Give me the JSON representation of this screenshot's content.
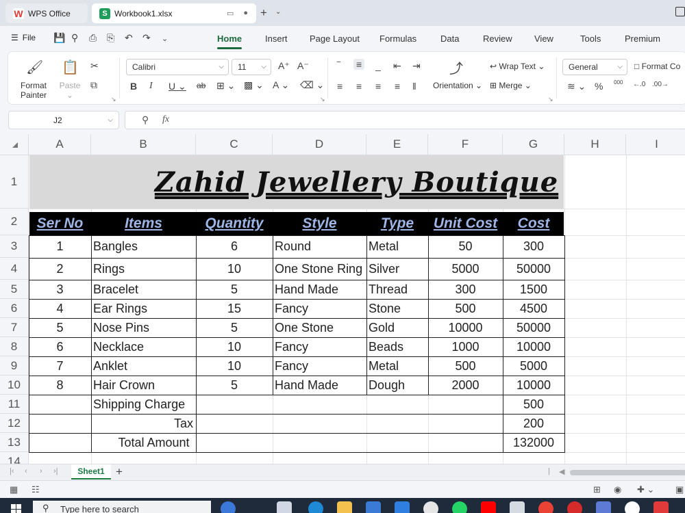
{
  "window": {
    "tabs": [
      {
        "label": "WPS Office",
        "logo": "W"
      },
      {
        "label": "Workbook1.xlsx",
        "logo": "S"
      }
    ]
  },
  "menu": {
    "file_label": "File",
    "items": [
      "Home",
      "Insert",
      "Page Layout",
      "Formulas",
      "Data",
      "Review",
      "View",
      "Tools",
      "Premium"
    ],
    "active": "Home"
  },
  "ribbon": {
    "format_painter": "Format Painter",
    "format_painter_l1": "Format",
    "format_painter_l2": "Painter",
    "paste": "Paste",
    "font_name": "Calibri",
    "font_size": "11",
    "wrap_text": "Wrap Text",
    "orientation": "Orientation",
    "merge": "Merge",
    "number_format": "General",
    "format_cells": "Format Co",
    "percent": "%",
    "thousands": "000"
  },
  "formula_bar": {
    "name_box": "J2",
    "fx": "fx",
    "content": ""
  },
  "sheet": {
    "columns": [
      "A",
      "B",
      "C",
      "D",
      "E",
      "F",
      "G",
      "H",
      "I"
    ],
    "rows": [
      "1",
      "2",
      "3",
      "4",
      "5",
      "6",
      "7",
      "8",
      "9",
      "10",
      "11",
      "12",
      "13",
      "14"
    ],
    "title": "Zahid Jewellery  Boutique",
    "headers": [
      "Ser No",
      "Items",
      "Quantity",
      "Style",
      "Type",
      "Unit Cost",
      "Cost"
    ],
    "data": [
      [
        "1",
        "Bangles",
        "6",
        "Round",
        "Metal",
        "50",
        "300"
      ],
      [
        "2",
        "Rings",
        "10",
        "One Stone Ring",
        "Silver",
        "5000",
        "50000"
      ],
      [
        "3",
        "Bracelet",
        "5",
        "Hand Made",
        "Thread",
        "300",
        "1500"
      ],
      [
        "4",
        "Ear Rings",
        "15",
        "Fancy",
        "Stone",
        "500",
        "4500"
      ],
      [
        "5",
        "Nose Pins",
        "5",
        "One Stone",
        "Gold",
        "10000",
        "50000"
      ],
      [
        "6",
        "Necklace",
        "10",
        "Fancy",
        "Beads",
        "1000",
        "10000"
      ],
      [
        "7",
        "Anklet",
        "10",
        "Fancy",
        "Metal",
        "500",
        "5000"
      ],
      [
        "8",
        "Hair Crown",
        "5",
        "Hand Made",
        "Dough",
        "2000",
        "10000"
      ]
    ],
    "summary": [
      {
        "label": "Shipping Charge",
        "value": "500"
      },
      {
        "label": "Tax",
        "value": "200"
      },
      {
        "label": "Total Amount",
        "value": "132000"
      }
    ]
  },
  "sheet_tabs": {
    "active": "Sheet1",
    "add": "+"
  },
  "taskbar": {
    "search_placeholder": "Type here to search"
  }
}
